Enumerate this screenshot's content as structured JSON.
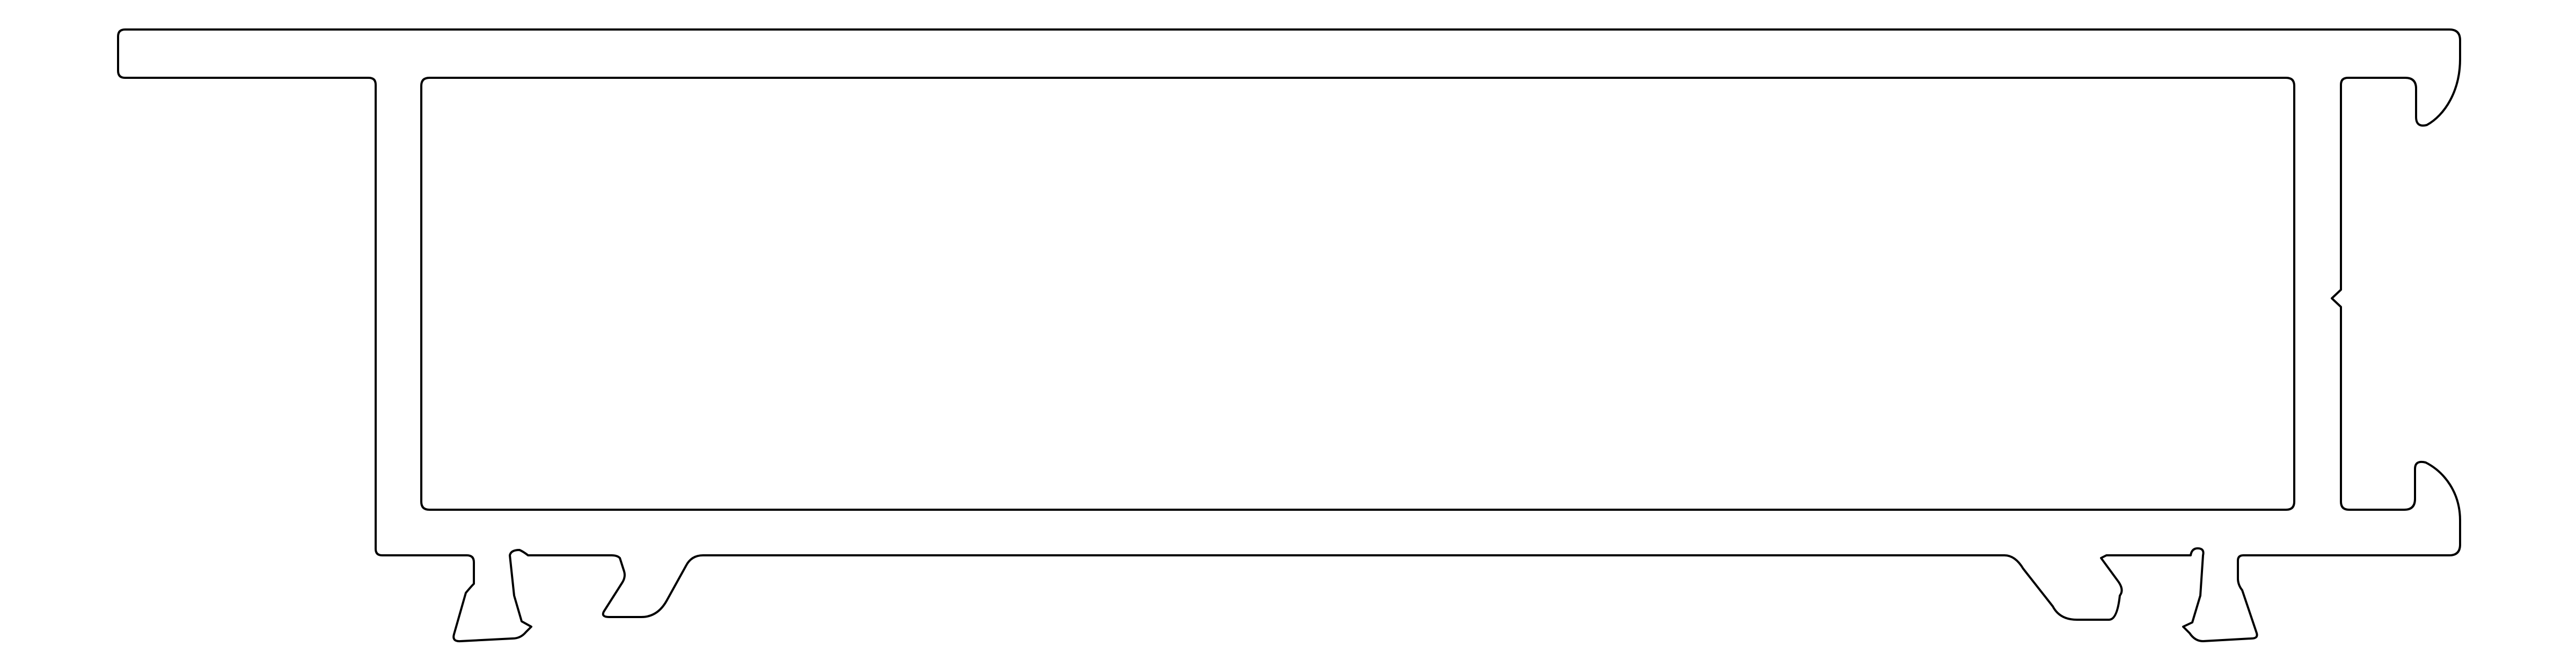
{
  "drawing": {
    "background_color": "#ffffff",
    "line_color": "#000000",
    "labels": []
  }
}
